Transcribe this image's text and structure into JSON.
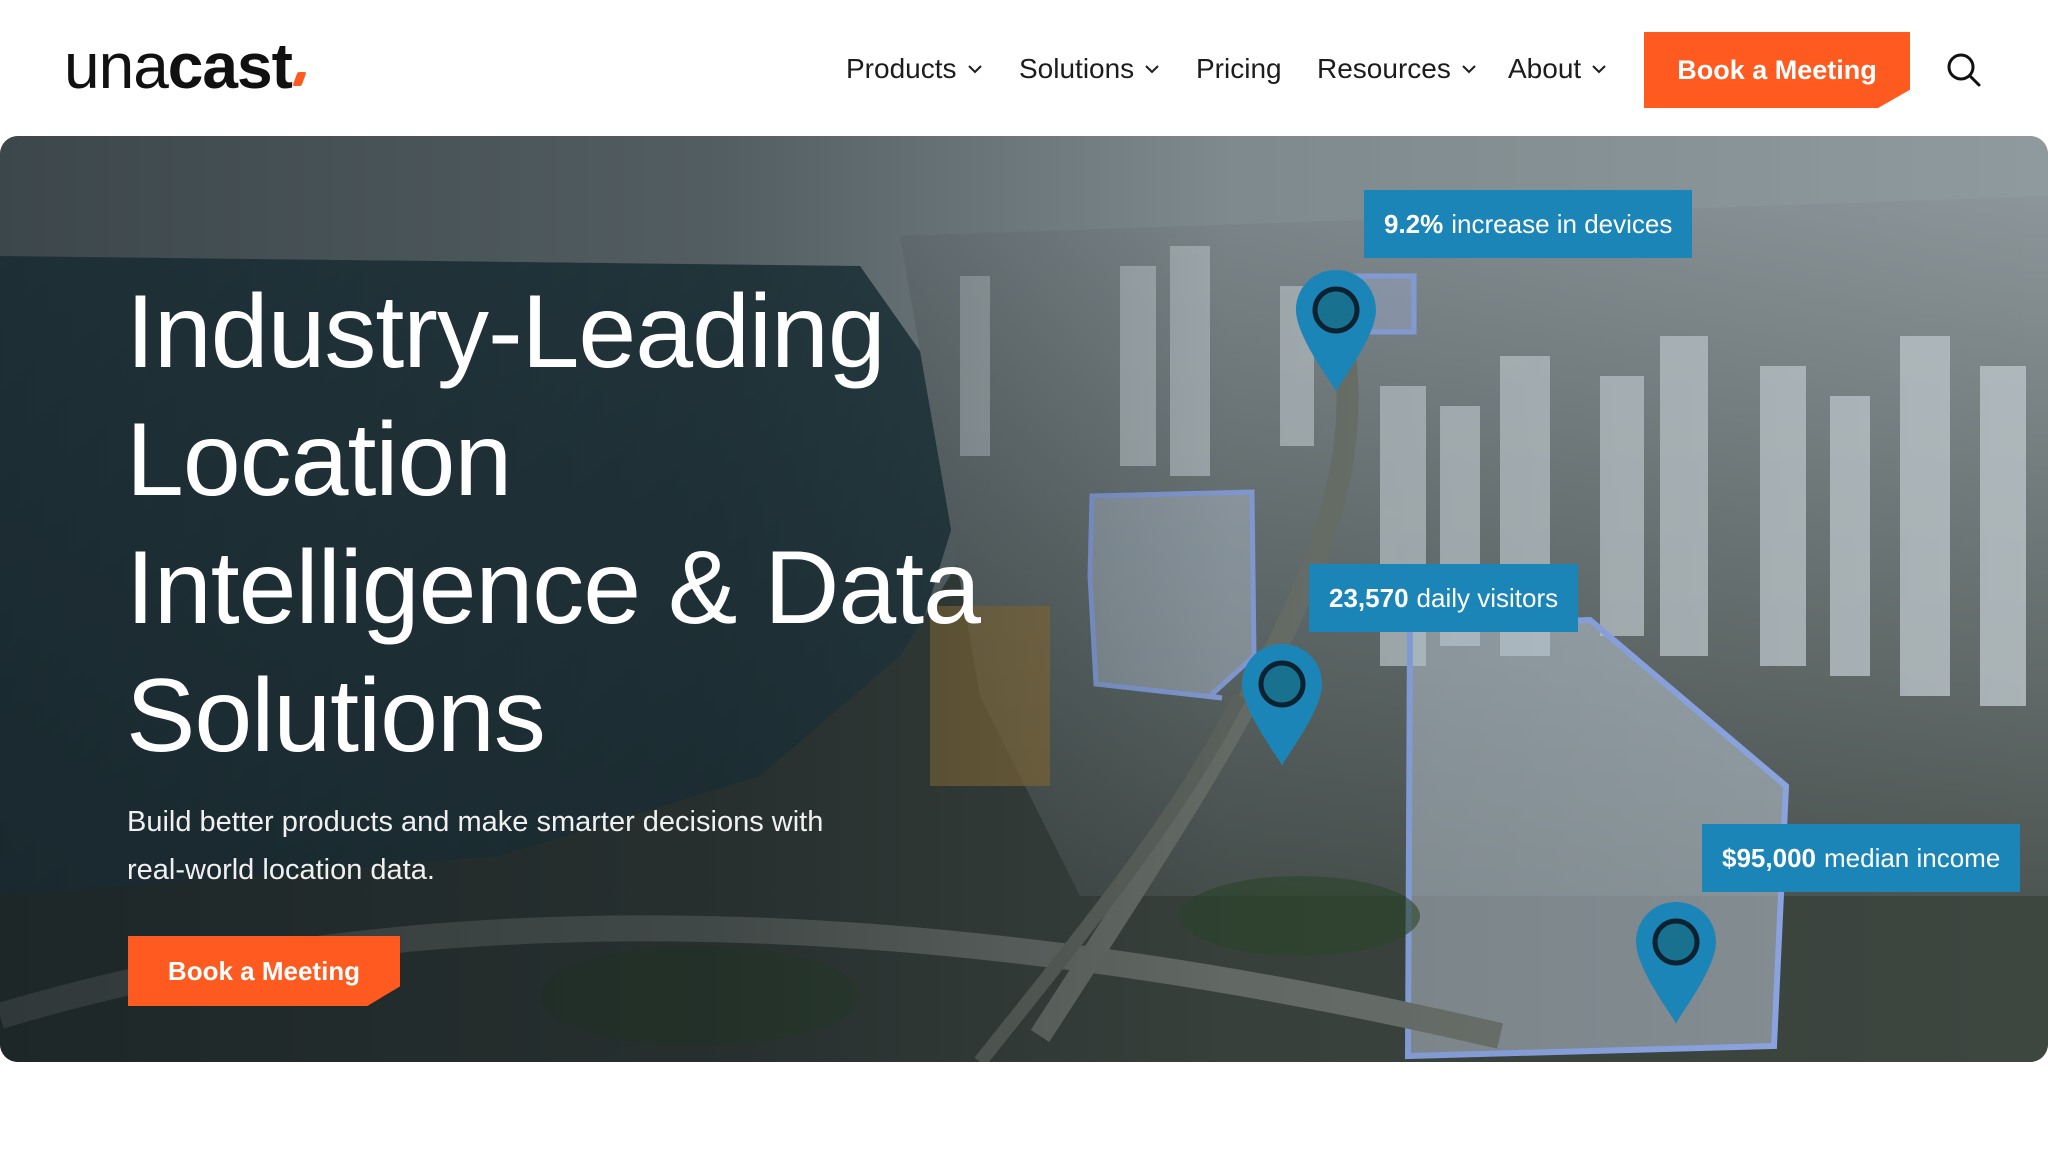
{
  "brand": {
    "logo_light": "una",
    "logo_bold": "cast",
    "accent": "#ff5a1f"
  },
  "nav": {
    "products": "Products",
    "solutions": "Solutions",
    "pricing": "Pricing",
    "resources": "Resources",
    "about": "About",
    "cta": "Book a Meeting",
    "search_icon": "search-icon",
    "dropdown_icon": "chevron-down-icon"
  },
  "hero": {
    "title_lines": [
      "Industry-Leading",
      "Location",
      "Intelligence & Data",
      "Solutions"
    ],
    "subtitle_lines": [
      "Build better products and make smarter decisions with",
      "real-world location data."
    ],
    "cta": "Book a Meeting",
    "stats": [
      {
        "value": "9.2%",
        "label": "increase in devices"
      },
      {
        "value": "23,570",
        "label": "daily visitors"
      },
      {
        "value": "$95,000",
        "label": "median income"
      }
    ],
    "pin_icon": "map-pin-icon",
    "stat_color": "#1c85b8"
  }
}
